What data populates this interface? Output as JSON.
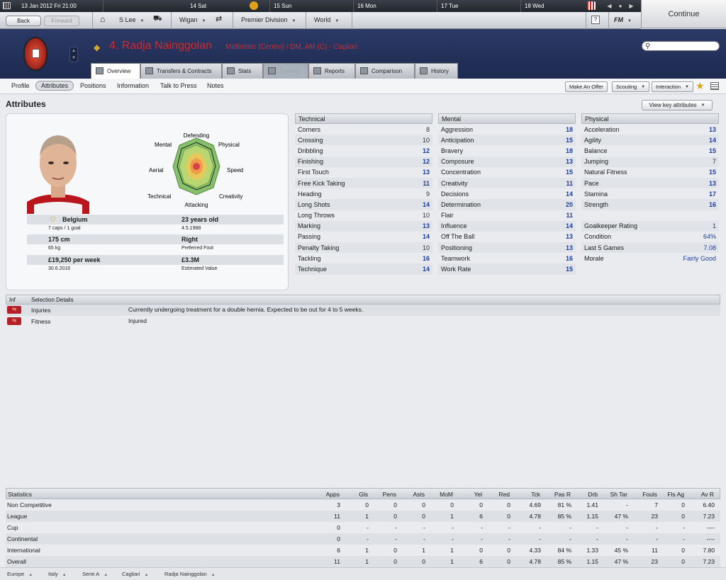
{
  "topbar": {
    "date": "13 Jan 2012  Fri 21:00",
    "days": [
      "14 Sat",
      "15 Sun",
      "16 Mon",
      "17 Tue",
      "18 Wed"
    ]
  },
  "continue_label": "Continue",
  "nav": {
    "back": "Back",
    "forward": "Forward",
    "manager": "S Lee",
    "club": "Wigan",
    "competition": "Premier Division",
    "world": "World",
    "fm": "FM"
  },
  "player": {
    "name": "4. Radja Nainggolan",
    "position": "Midfielder (Centre) / DM, AM (C) - Cagliari"
  },
  "tabs": [
    "Overview",
    "Transfers & Contracts",
    "Stats",
    "Training",
    "Reports",
    "Comparison",
    "History"
  ],
  "subnav": {
    "items": [
      "Profile",
      "Attributes",
      "Positions",
      "Information",
      "Talk to Press",
      "Notes"
    ],
    "offer": "Make An Offer",
    "scouting": "Scouting",
    "interaction": "Interaction"
  },
  "section_title": "Attributes",
  "view_key": "View key attributes",
  "radar_labels": [
    "Defending",
    "Physical",
    "Speed",
    "Creativity",
    "Attacking",
    "Technical",
    "Aerial",
    "Mental"
  ],
  "info": {
    "nation": "Belgium",
    "caps": "7 caps / 1 goal",
    "age": "23 years old",
    "dob": "4.5.1988",
    "height": "175 cm",
    "weight": "65 kg",
    "foot": "Right",
    "foot_label": "Preferred Foot",
    "wage": "£19,250 per week",
    "contract": "30.6.2016",
    "value": "£3.3M",
    "value_label": "Estimated Value"
  },
  "technical": {
    "title": "Technical",
    "rows": [
      [
        "Corners",
        "8"
      ],
      [
        "Crossing",
        "10"
      ],
      [
        "Dribbling",
        "12"
      ],
      [
        "Finishing",
        "12"
      ],
      [
        "First Touch",
        "13"
      ],
      [
        "Free Kick Taking",
        "11"
      ],
      [
        "Heading",
        "9"
      ],
      [
        "Long Shots",
        "14"
      ],
      [
        "Long Throws",
        "10"
      ],
      [
        "Marking",
        "13"
      ],
      [
        "Passing",
        "14"
      ],
      [
        "Penalty Taking",
        "10"
      ],
      [
        "Tackling",
        "16"
      ],
      [
        "Technique",
        "14"
      ]
    ]
  },
  "mental": {
    "title": "Mental",
    "rows": [
      [
        "Aggression",
        "18"
      ],
      [
        "Anticipation",
        "15"
      ],
      [
        "Bravery",
        "18"
      ],
      [
        "Composure",
        "13"
      ],
      [
        "Concentration",
        "15"
      ],
      [
        "Creativity",
        "11"
      ],
      [
        "Decisions",
        "14"
      ],
      [
        "Determination",
        "20"
      ],
      [
        "Flair",
        "11"
      ],
      [
        "Influence",
        "14"
      ],
      [
        "Off The Ball",
        "13"
      ],
      [
        "Positioning",
        "13"
      ],
      [
        "Teamwork",
        "16"
      ],
      [
        "Work Rate",
        "15"
      ]
    ]
  },
  "physical": {
    "title": "Physical",
    "rows": [
      [
        "Acceleration",
        "13"
      ],
      [
        "Agility",
        "14"
      ],
      [
        "Balance",
        "15"
      ],
      [
        "Jumping",
        "7"
      ],
      [
        "Natural Fitness",
        "15"
      ],
      [
        "Pace",
        "13"
      ],
      [
        "Stamina",
        "17"
      ],
      [
        "Strength",
        "16"
      ]
    ],
    "extra": [
      [
        "Goalkeeper Rating",
        "1"
      ],
      [
        "Condition",
        "64%"
      ],
      [
        "Last 5 Games",
        "7.08"
      ],
      [
        "Morale",
        "Fairly Good"
      ]
    ]
  },
  "selection": {
    "head_inf": "Inf",
    "head_details": "Selection Details",
    "badge": "Inj",
    "rows": [
      [
        "Injuries",
        "Currently undergoing treatment for a double hernia. Expected to be out for 4 to 5 weeks."
      ],
      [
        "Fitness",
        "Injured"
      ]
    ]
  },
  "stats": {
    "headers": [
      "Statistics",
      "Apps",
      "Gls",
      "Pens",
      "Asts",
      "MoM",
      "Yel",
      "Red",
      "Tck",
      "Pas R",
      "Drb",
      "Sh Tar",
      "Fouls",
      "Fls Ag",
      "Av R"
    ],
    "rows": [
      [
        "Non Competitive",
        "3",
        "0",
        "0",
        "0",
        "0",
        "0",
        "0",
        "4.69",
        "81 %",
        "1.41",
        "-",
        "7",
        "0",
        "6.40"
      ],
      [
        "League",
        "11",
        "1",
        "0",
        "0",
        "1",
        "6",
        "0",
        "4.78",
        "85 %",
        "1.15",
        "47 %",
        "23",
        "0",
        "7.23"
      ],
      [
        "Cup",
        "0",
        "-",
        "-",
        "-",
        "-",
        "-",
        "-",
        "-",
        "-",
        "-",
        "-",
        "-",
        "-",
        "----"
      ],
      [
        "Continental",
        "0",
        "-",
        "-",
        "-",
        "-",
        "-",
        "-",
        "-",
        "-",
        "-",
        "-",
        "-",
        "-",
        "----"
      ],
      [
        "International",
        "6",
        "1",
        "0",
        "1",
        "1",
        "0",
        "0",
        "4.33",
        "84 %",
        "1.33",
        "45 %",
        "11",
        "0",
        "7.80"
      ],
      [
        "Overall",
        "11",
        "1",
        "0",
        "0",
        "1",
        "6",
        "0",
        "4.78",
        "85 %",
        "1.15",
        "47 %",
        "23",
        "0",
        "7.23"
      ]
    ]
  },
  "breadcrumb": [
    "Europe",
    "Italy",
    "Serie A",
    "Cagliari",
    "Radja Nainggolan"
  ]
}
